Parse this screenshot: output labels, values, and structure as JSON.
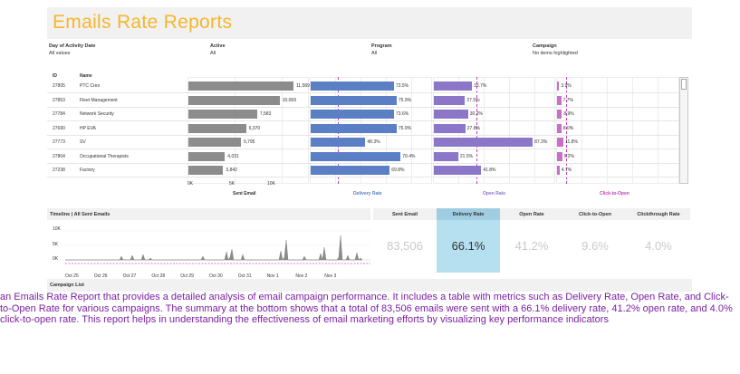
{
  "title": "Emails Rate Reports",
  "filters": [
    {
      "label": "Day of Activity Date",
      "value": "All values"
    },
    {
      "label": "Active",
      "value": "All"
    },
    {
      "label": "Program",
      "value": "All"
    },
    {
      "label": "Campaign",
      "value": "No items highlighted"
    }
  ],
  "table": {
    "col_id": "ID",
    "col_name": "Name",
    "rows": [
      {
        "id": "27805",
        "name": "PTC Creo",
        "sent": 11589,
        "sent_label": "11,589",
        "delivery": 73.5,
        "delivery_label": "73.5%",
        "open": 33.7,
        "open_label": "33.7%",
        "cto": 3.9,
        "cto_label": "3.9%"
      },
      {
        "id": "27853",
        "name": "Fleet Management",
        "sent": 10069,
        "sent_label": "10,069",
        "delivery": 75.9,
        "delivery_label": "75.9%",
        "open": 27.5,
        "open_label": "27.5%",
        "cto": 7.7,
        "cto_label": "7.7%"
      },
      {
        "id": "27784",
        "name": "Network Security",
        "sent": 7583,
        "sent_label": "7,583",
        "delivery": 73.6,
        "delivery_label": "73.6%",
        "open": 30.2,
        "open_label": "30.2%",
        "cto": 8.9,
        "cto_label": "8.9%"
      },
      {
        "id": "27690",
        "name": "HP EVA",
        "sent": 6370,
        "sent_label": "6,370",
        "delivery": 75.9,
        "delivery_label": "75.9%",
        "open": 27.8,
        "open_label": "27.8%",
        "cto": 8.0,
        "cto_label": "8.0%"
      },
      {
        "id": "27773",
        "name": "SV",
        "sent": 5795,
        "sent_label": "5,795",
        "delivery": 48.3,
        "delivery_label": "48.3%",
        "open": 87.3,
        "open_label": "87.3%",
        "cto": 11.8,
        "cto_label": "11.8%"
      },
      {
        "id": "27804",
        "name": "Occupational Therapists",
        "sent": 4031,
        "sent_label": "4,031",
        "delivery": 79.4,
        "delivery_label": "79.4%",
        "open": 21.5,
        "open_label": "21.5%",
        "cto": 9.2,
        "cto_label": "9.2%"
      },
      {
        "id": "27238",
        "name": "Factory",
        "sent": 3842,
        "sent_label": "3,842",
        "delivery": 69.8,
        "delivery_label": "69.8%",
        "open": 41.8,
        "open_label": "41.8%",
        "cto": 4.7,
        "cto_label": "4.7%"
      }
    ],
    "sent_axis": {
      "ticks": [
        "0K",
        "5K",
        "10K"
      ],
      "max": 13000,
      "title": "Sent Email"
    },
    "delivery_axis_title": "Delivery Rate",
    "open_axis_title": "Open Rate",
    "cto_axis_title": "Click-to-Open",
    "bar_colors": {
      "sent": "#8c8c8c",
      "delivery": "#5b7fc4",
      "open": "#8b76c8",
      "cto": "#c76fc9"
    }
  },
  "timeline": {
    "title": "Timeline | All Sent Emails",
    "y_ticks": [
      "10K",
      "5K",
      "0K"
    ],
    "x_ticks": [
      "Oct 25",
      "Oct 26",
      "Oct 27",
      "Oct 28",
      "Oct 29",
      "Oct 30",
      "Oct 31",
      "Nov 1",
      "Nov 2",
      "Nov 3"
    ]
  },
  "kpis": [
    {
      "label": "Sent Email",
      "value": "83,506",
      "selected": false
    },
    {
      "label": "Delivery Rate",
      "value": "66.1%",
      "selected": true
    },
    {
      "label": "Open Rate",
      "value": "41.2%",
      "selected": false
    },
    {
      "label": "Click-to-Open",
      "value": "9.6%",
      "selected": false
    },
    {
      "label": "Clickthrough Rate",
      "value": "4.0%",
      "selected": false
    }
  ],
  "campaign_list_label": "Campaign List",
  "caption": "an Emails Rate Report that provides a detailed analysis of email campaign performance. It includes a table with metrics such as Delivery Rate, Open Rate, and Click-to-Open Rate for various campaigns. The summary at the bottom shows that a total of 83,506 emails were sent with a 66.1% delivery rate, 41.2% open rate, and 4.0% click-to-open rate. This report helps in understanding the effectiveness of email marketing efforts by visualizing key performance indicators"
}
